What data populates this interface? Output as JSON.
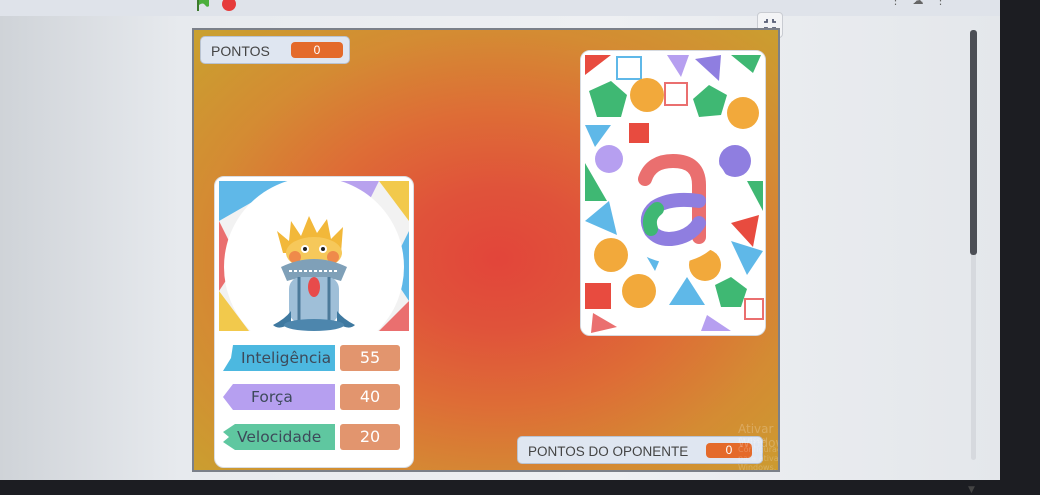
{
  "toolbar": {
    "green_flag_icon": "green-flag-icon",
    "stop_icon": "stop-icon",
    "fullscreen_icon": "fullscreen-exit-icon"
  },
  "player_score": {
    "label": "PONTOS",
    "value": "0"
  },
  "opponent_score": {
    "label": "PONTOS DO OPONENTE",
    "value": "0"
  },
  "player_card": {
    "character_icon": "yeti-character-icon",
    "stats": [
      {
        "label": "Inteligência",
        "value": "55",
        "color": "#4cb8e0"
      },
      {
        "label": "Força",
        "value": "40",
        "color": "#b69ff0"
      },
      {
        "label": "Velocidade",
        "value": "20",
        "color": "#5fc7a0"
      }
    ]
  },
  "opponent_card": {
    "letter": "a",
    "back_icon": "card-back-icon"
  },
  "watermark": {
    "title": "Ativar o Windows",
    "subtitle": "Acesse Configurações para ativar o Windows."
  },
  "colors": {
    "stage_center": "#e2453a",
    "stage_edge": "#c9a12f",
    "score_value_bg": "#e46a2a",
    "stat_value_bg": "#e2956e"
  }
}
